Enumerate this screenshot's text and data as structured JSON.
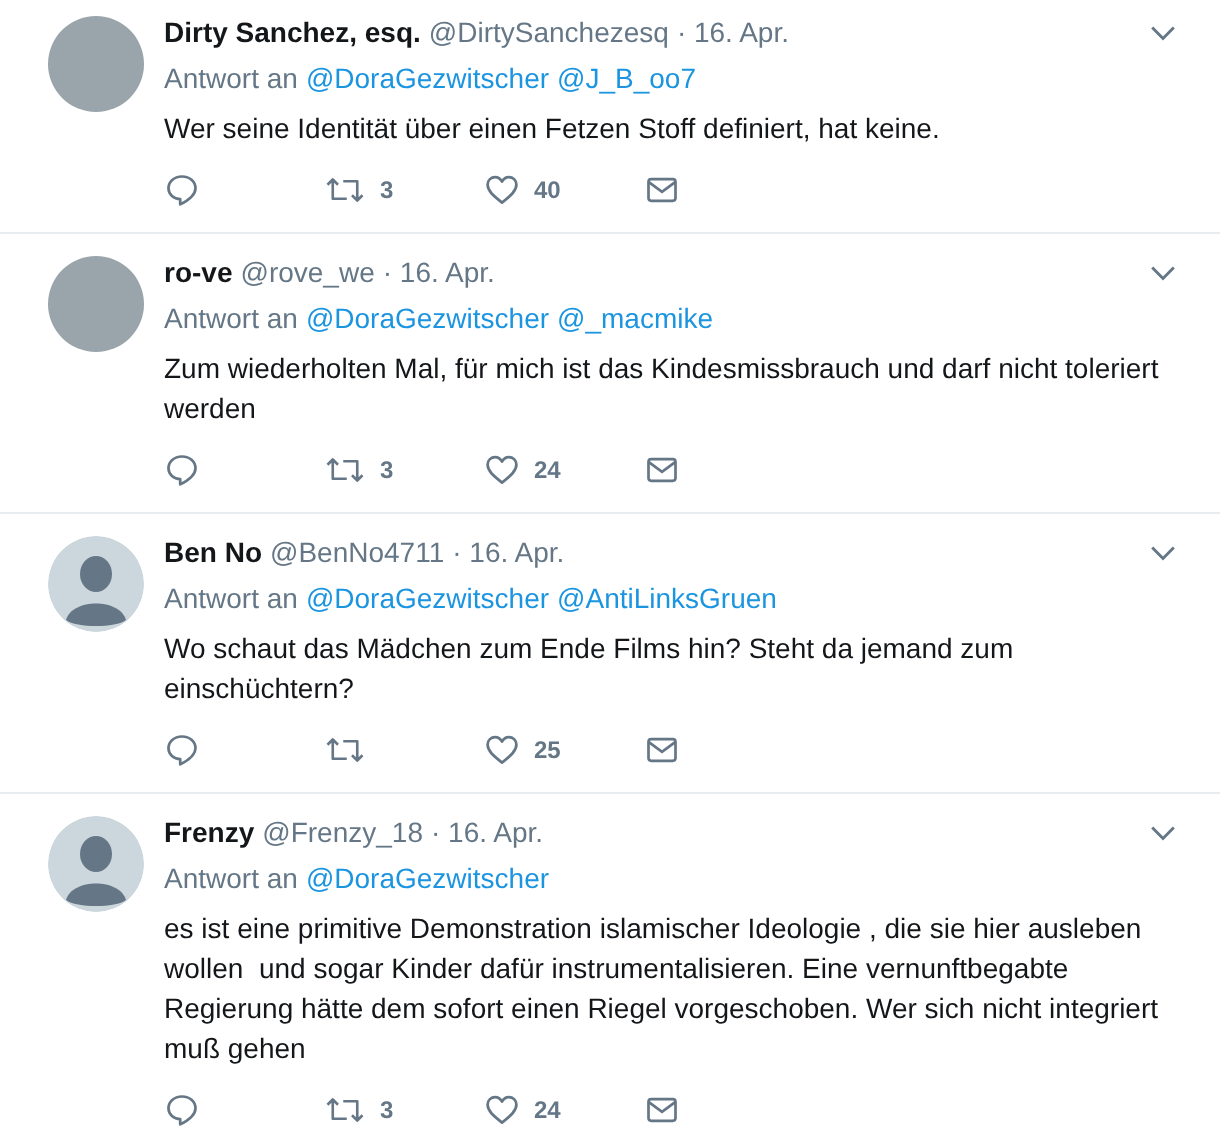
{
  "tweets": [
    {
      "avatar": {
        "kind": "photo"
      },
      "name": "Dirty Sanchez, esq.",
      "handle": "@DirtySanchezesq",
      "date": "· 16. Apr.",
      "reply_prefix": "Antwort an",
      "mentions": [
        "@DoraGezwitscher",
        "@J_B_oo7"
      ],
      "text": "Wer seine Identität über einen Fetzen Stoff definiert, hat keine.",
      "retweets": "3",
      "likes": "40"
    },
    {
      "avatar": {
        "kind": "photo"
      },
      "name": "ro-ve",
      "handle": "@rove_we",
      "date": "· 16. Apr.",
      "reply_prefix": "Antwort an",
      "mentions": [
        "@DoraGezwitscher",
        "@_macmike"
      ],
      "text": "Zum wiederholten Mal, für mich ist das Kindesmissbrauch und darf nicht toleriert werden",
      "retweets": "3",
      "likes": "24"
    },
    {
      "avatar": {
        "kind": "default"
      },
      "name": "Ben No",
      "handle": "@BenNo4711",
      "date": "· 16. Apr.",
      "reply_prefix": "Antwort an",
      "mentions": [
        "@DoraGezwitscher",
        "@AntiLinksGruen"
      ],
      "text": "Wo schaut das Mädchen zum Ende Films hin? Steht da jemand zum einschüchtern?",
      "likes": "25"
    },
    {
      "avatar": {
        "kind": "default"
      },
      "name": "Frenzy",
      "handle": "@Frenzy_18",
      "date": "· 16. Apr.",
      "reply_prefix": "Antwort an",
      "mentions": [
        "@DoraGezwitscher"
      ],
      "text": "es ist eine primitive Demonstration islamischer Ideologie , die sie hier ausleben wollen  und sogar Kinder dafür instrumentalisieren. Eine vernunftbegabte Regierung hätte dem sofort einen Riegel vorgeschoben. Wer sich nicht integriert muß gehen",
      "retweets": "3",
      "likes": "24"
    }
  ]
}
